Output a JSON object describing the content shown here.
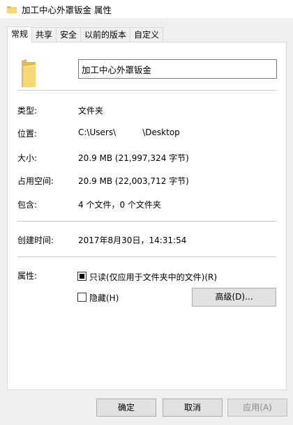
{
  "window": {
    "title": "加工中心外罩钣金 属性"
  },
  "tabs": [
    {
      "label": "常规",
      "active": true
    },
    {
      "label": "共享"
    },
    {
      "label": "安全"
    },
    {
      "label": "以前的版本"
    },
    {
      "label": "自定义"
    }
  ],
  "general": {
    "folder_icon": "folder-icon",
    "name": "加工中心外罩钣金",
    "type_label": "类型:",
    "type_value": "文件夹",
    "location_label": "位置:",
    "location_value": "C:\\Users\\          \\Desktop",
    "size_label": "大小:",
    "size_value": "20.9 MB (21,997,324 字节)",
    "size_on_disk_label": "占用空间:",
    "size_on_disk_value": "20.9 MB (22,003,712 字节)",
    "contains_label": "包含:",
    "contains_value": "4 个文件，0 个文件夹",
    "created_label": "创建时间:",
    "created_value": "2017年8月30日，14:31:54",
    "attributes_label": "属性:",
    "readonly_label": "只读(仅应用于文件夹中的文件)(R)",
    "readonly_checked": true,
    "hidden_label": "隐藏(H)",
    "hidden_checked": false,
    "advanced_button": "高级(D)..."
  },
  "footer": {
    "ok": "确定",
    "cancel": "取消",
    "apply": "应用(A)"
  },
  "colors": {
    "folder_yellow": "#f8d775",
    "folder_dark": "#e6b84a",
    "tab_border": "#d9d9d9"
  }
}
